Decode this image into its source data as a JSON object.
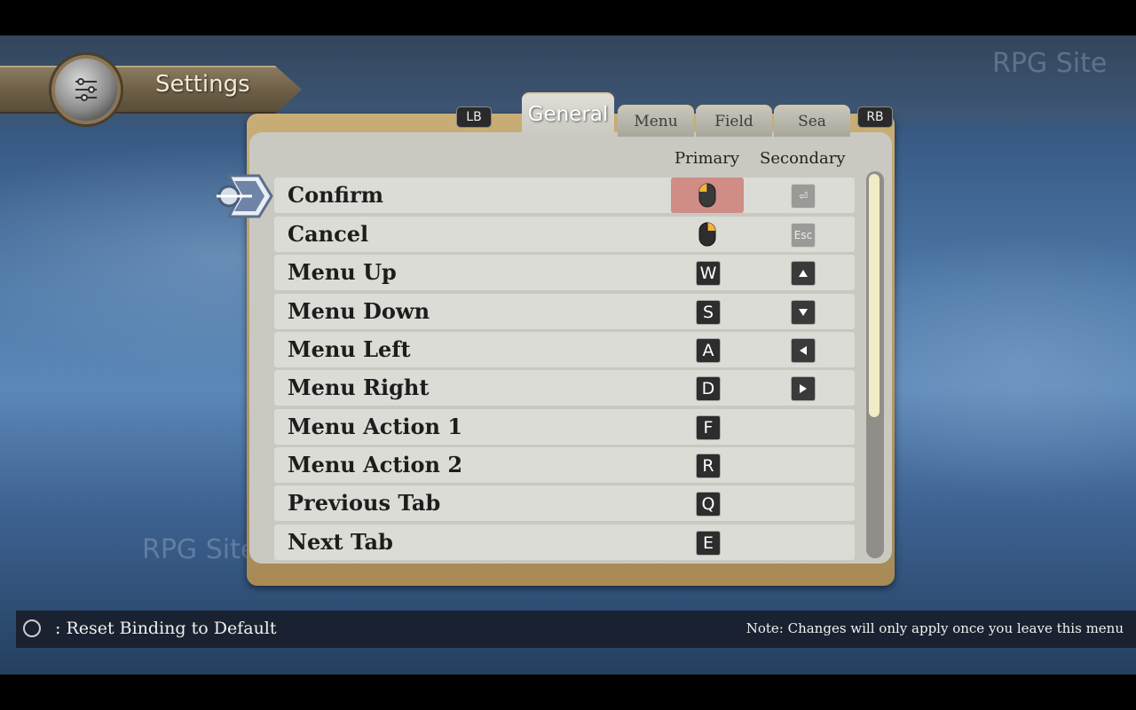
{
  "header": {
    "title": "Settings",
    "icon": "sliders-icon"
  },
  "watermarks": [
    "RPG Site",
    "RPG Site"
  ],
  "tabs": {
    "left_shoulder": "LB",
    "right_shoulder": "RB",
    "items": [
      {
        "label": "General",
        "active": true
      },
      {
        "label": "Menu"
      },
      {
        "label": "Field"
      },
      {
        "label": "Sea"
      }
    ]
  },
  "columns": {
    "primary": "Primary",
    "secondary": "Secondary"
  },
  "bindings": [
    {
      "action": "Confirm",
      "primary": "left-click-icon",
      "secondary": "enter-key-icon",
      "selected": true
    },
    {
      "action": "Cancel",
      "primary": "right-click-icon",
      "secondary": "Esc"
    },
    {
      "action": "Menu Up",
      "primary": "W",
      "secondary": "arrow-up-icon"
    },
    {
      "action": "Menu Down",
      "primary": "S",
      "secondary": "arrow-down-icon"
    },
    {
      "action": "Menu Left",
      "primary": "A",
      "secondary": "arrow-left-icon"
    },
    {
      "action": "Menu Right",
      "primary": "D",
      "secondary": "arrow-right-icon"
    },
    {
      "action": "Menu Action 1",
      "primary": "F",
      "secondary": ""
    },
    {
      "action": "Menu Action 2",
      "primary": "R",
      "secondary": ""
    },
    {
      "action": "Previous Tab",
      "primary": "Q",
      "secondary": ""
    },
    {
      "action": "Next Tab",
      "primary": "E",
      "secondary": ""
    }
  ],
  "footer": {
    "hint": ": Reset Binding to Default",
    "note": "Note: Changes will only apply once you leave this menu"
  },
  "colors": {
    "selected_row": "#cf8d86",
    "panel": "#c9c9c2",
    "scroll_thumb": "#efecc6"
  }
}
